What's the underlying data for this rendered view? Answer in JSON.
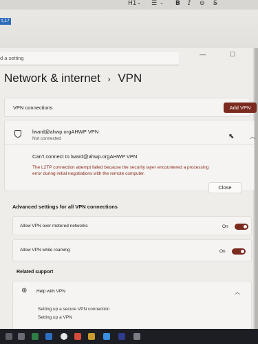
{
  "editor": {
    "heading_selector": "H1",
    "bold_label": "B",
    "chip_text": "t,17"
  },
  "window": {
    "search_placeholder": "d a setting",
    "breadcrumb_parent": "Network & internet",
    "breadcrumb_separator": "›",
    "breadcrumb_current": "VPN"
  },
  "vpn_connections": {
    "label": "VPN connections",
    "add_button": "Add VPN"
  },
  "connection": {
    "name": "lward@ahwp.orgAHWP VPN",
    "status": "Not connected",
    "error_title": "Can't connect to  lward@ahwp.orgAHWP VPN",
    "error_line1": "The L2TP connection attempt failed because the security layer encountered a processing",
    "error_line2": "error during initial negotiations with the remote computer.",
    "close_button": "Close"
  },
  "advanced": {
    "title": "Advanced settings for all VPN connections",
    "metered_label": "Allow VPN over metered networks",
    "metered_state": "On",
    "roaming_label": "Allow VPN while roaming",
    "roaming_state": "On"
  },
  "support": {
    "title": "Related support",
    "help_label": "Help with VPN",
    "link1": "Setting up a secure VPN connection",
    "link2": "Setting up a VPN"
  },
  "colors": {
    "accent": "#7a2a1f",
    "error_text": "#8a2b1e"
  }
}
